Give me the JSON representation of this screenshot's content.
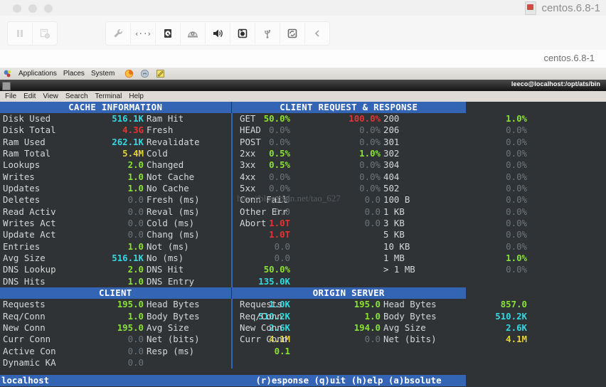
{
  "window": {
    "vm_title": "centos.6.8-1",
    "tab_name": "centos.6.8-1",
    "dots": [
      "minimize",
      "maximize",
      "close"
    ]
  },
  "toolbar": {
    "left_buttons": [
      {
        "name": "pause-button",
        "icon": "pause-icon"
      },
      {
        "name": "snapshot-button",
        "icon": "snapshot-icon"
      }
    ],
    "right_buttons": [
      {
        "name": "settings-button",
        "icon": "wrench-icon"
      },
      {
        "name": "network-button",
        "icon": "network-icon"
      },
      {
        "name": "harddisk-button",
        "icon": "harddisk-icon"
      },
      {
        "name": "cd-drive-button",
        "icon": "cd-drive-icon"
      },
      {
        "name": "sound-button",
        "icon": "speaker-icon"
      },
      {
        "name": "camera-button",
        "icon": "camera-icon"
      },
      {
        "name": "usb-button",
        "icon": "usb-icon"
      },
      {
        "name": "sync-button",
        "icon": "sync-icon"
      },
      {
        "name": "collapse-button",
        "icon": "chevron-left-icon"
      }
    ]
  },
  "gnome_panel": {
    "menus": [
      "Applications",
      "Places",
      "System"
    ],
    "launchers": [
      "firefox-icon",
      "help-icon",
      "text-editor-icon"
    ]
  },
  "terminal": {
    "title": "leeco@localhost:/opt/ats/bin",
    "menus": [
      "File",
      "Edit",
      "View",
      "Search",
      "Terminal",
      "Help"
    ],
    "watermark": "http://blog.csdn.net/tao_627"
  },
  "status": {
    "host": "localhost",
    "keys": "(r)esponse (q)uit (h)elp (a)bsolute"
  },
  "sections": [
    {
      "id": "cache",
      "header_left": "CACHE INFORMATION",
      "header_right": "CLIENT REQUEST & RESPONSE",
      "left": [
        {
          "label": "Disk Used",
          "value": "516.1K",
          "color": "c-cyan"
        },
        {
          "label": "Disk Total",
          "value": "4.3G",
          "color": "c-red"
        },
        {
          "label": "Ram Used",
          "value": "262.1K",
          "color": "c-cyan"
        },
        {
          "label": "Ram Total",
          "value": "5.4M",
          "color": "c-yellow"
        },
        {
          "label": "Lookups",
          "value": "2.0",
          "color": "c-green"
        },
        {
          "label": "Writes",
          "value": "1.0",
          "color": "c-green"
        },
        {
          "label": "Updates",
          "value": "1.0",
          "color": "c-green"
        },
        {
          "label": "Deletes",
          "value": "0.0",
          "color": "c-dim"
        },
        {
          "label": "Read Activ",
          "value": "0.0",
          "color": "c-dim"
        },
        {
          "label": "Writes Act",
          "value": "0.0",
          "color": "c-dim"
        },
        {
          "label": "Update Act",
          "value": "0.0",
          "color": "c-dim"
        },
        {
          "label": "Entries",
          "value": "1.0",
          "color": "c-green"
        },
        {
          "label": "Avg Size",
          "value": "516.1K",
          "color": "c-cyan"
        },
        {
          "label": "DNS Lookup",
          "value": "2.0",
          "color": "c-green"
        },
        {
          "label": "DNS Hits",
          "value": "1.0",
          "color": "c-green"
        }
      ],
      "left2": [
        {
          "label": "Ram Hit",
          "value": "50.0%",
          "color": "c-green"
        },
        {
          "label": "Fresh",
          "value": "0.0%",
          "color": "c-dim"
        },
        {
          "label": "Revalidate",
          "value": "0.0%",
          "color": "c-dim"
        },
        {
          "label": "Cold",
          "value": "0.5%",
          "color": "c-green"
        },
        {
          "label": "Changed",
          "value": "0.5%",
          "color": "c-green"
        },
        {
          "label": "Not Cache",
          "value": "0.0%",
          "color": "c-dim"
        },
        {
          "label": "No Cache",
          "value": "0.0%",
          "color": "c-dim"
        },
        {
          "label": "Fresh (ms)",
          "value": "0.0",
          "color": "c-dim"
        },
        {
          "label": "Reval (ms)",
          "value": "0.0",
          "color": "c-dim"
        },
        {
          "label": "Cold (ms)",
          "value": "1.0T",
          "color": "c-red"
        },
        {
          "label": "Chang (ms)",
          "value": "1.0T",
          "color": "c-red"
        },
        {
          "label": "Not (ms)",
          "value": "0.0",
          "color": "c-dim"
        },
        {
          "label": "No (ms)",
          "value": "0.0",
          "color": "c-dim"
        },
        {
          "label": "DNS Hit",
          "value": "50.0%",
          "color": "c-green"
        },
        {
          "label": "DNS Entry",
          "value": "135.0K",
          "color": "c-cyan"
        }
      ],
      "right": [
        {
          "label": "GET",
          "value": "100.0%",
          "color": "c-red"
        },
        {
          "label": "HEAD",
          "value": "0.0%",
          "color": "c-dim"
        },
        {
          "label": "POST",
          "value": "0.0%",
          "color": "c-dim"
        },
        {
          "label": "2xx",
          "value": "1.0%",
          "color": "c-green"
        },
        {
          "label": "3xx",
          "value": "0.0%",
          "color": "c-dim"
        },
        {
          "label": "4xx",
          "value": "0.0%",
          "color": "c-dim"
        },
        {
          "label": "5xx",
          "value": "0.0%",
          "color": "c-dim"
        },
        {
          "label": "Conn Fail",
          "value": "0.0",
          "color": "c-dim"
        },
        {
          "label": "Other Err",
          "value": "0.0",
          "color": "c-dim"
        },
        {
          "label": "Abort",
          "value": "0.0",
          "color": "c-dim"
        },
        {
          "label": "",
          "value": "",
          "color": "c-dim"
        },
        {
          "label": "",
          "value": "",
          "color": "c-dim"
        },
        {
          "label": "",
          "value": "",
          "color": "c-dim"
        },
        {
          "label": "",
          "value": "",
          "color": "c-dim"
        },
        {
          "label": "",
          "value": "",
          "color": "c-dim"
        }
      ],
      "right2": [
        {
          "label": "200",
          "value": "1.0%",
          "color": "c-green"
        },
        {
          "label": "206",
          "value": "0.0%",
          "color": "c-dim"
        },
        {
          "label": "301",
          "value": "0.0%",
          "color": "c-dim"
        },
        {
          "label": "302",
          "value": "0.0%",
          "color": "c-dim"
        },
        {
          "label": "304",
          "value": "0.0%",
          "color": "c-dim"
        },
        {
          "label": "404",
          "value": "0.0%",
          "color": "c-dim"
        },
        {
          "label": "502",
          "value": "0.0%",
          "color": "c-dim"
        },
        {
          "label": "100 B",
          "value": "0.0%",
          "color": "c-dim"
        },
        {
          "label": "1 KB",
          "value": "0.0%",
          "color": "c-dim"
        },
        {
          "label": "3 KB",
          "value": "0.0%",
          "color": "c-dim"
        },
        {
          "label": "5 KB",
          "value": "0.0%",
          "color": "c-dim"
        },
        {
          "label": "10 KB",
          "value": "0.0%",
          "color": "c-dim"
        },
        {
          "label": "1 MB",
          "value": "1.0%",
          "color": "c-green"
        },
        {
          "label": "> 1 MB",
          "value": "0.0%",
          "color": "c-dim"
        },
        {
          "label": "",
          "value": "",
          "color": "c-dim"
        }
      ]
    },
    {
      "id": "client",
      "header_left": "CLIENT",
      "header_right": "ORIGIN SERVER",
      "left": [
        {
          "label": "Requests",
          "value": "195.0",
          "color": "c-green"
        },
        {
          "label": "Req/Conn",
          "value": "1.0",
          "color": "c-green"
        },
        {
          "label": "New Conn",
          "value": "195.0",
          "color": "c-green"
        },
        {
          "label": "Curr Conn",
          "value": "0.0",
          "color": "c-dim"
        },
        {
          "label": "Active Con",
          "value": "0.0",
          "color": "c-dim"
        },
        {
          "label": "Dynamic KA",
          "value": "0.0",
          "color": "c-dim"
        }
      ],
      "left2": [
        {
          "label": "Head Bytes",
          "value": "1.0K",
          "color": "c-cyan"
        },
        {
          "label": "Body Bytes",
          "value": "510.2K",
          "color": "c-cyan"
        },
        {
          "label": "Avg Size",
          "value": "2.6K",
          "color": "c-cyan"
        },
        {
          "label": "Net (bits)",
          "value": "4.1M",
          "color": "c-yellow"
        },
        {
          "label": "Resp (ms)",
          "value": "0.1",
          "color": "c-green"
        },
        {
          "label": "",
          "value": "",
          "color": "c-dim"
        }
      ],
      "right": [
        {
          "label": "Requests",
          "value": "195.0",
          "color": "c-green"
        },
        {
          "label": "Req/Conn",
          "value": "1.0",
          "color": "c-green"
        },
        {
          "label": "New Conn",
          "value": "194.0",
          "color": "c-green"
        },
        {
          "label": "Curr Conn",
          "value": "0.0",
          "color": "c-dim"
        },
        {
          "label": "",
          "value": "",
          "color": "c-dim"
        },
        {
          "label": "",
          "value": "",
          "color": "c-dim"
        }
      ],
      "right2": [
        {
          "label": "Head Bytes",
          "value": "857.0",
          "color": "c-green"
        },
        {
          "label": "Body Bytes",
          "value": "510.2K",
          "color": "c-cyan"
        },
        {
          "label": "Avg Size",
          "value": "2.6K",
          "color": "c-cyan"
        },
        {
          "label": "Net (bits)",
          "value": "4.1M",
          "color": "c-yellow"
        },
        {
          "label": "",
          "value": "",
          "color": "c-dim"
        },
        {
          "label": "",
          "value": "",
          "color": "c-dim"
        }
      ]
    }
  ]
}
